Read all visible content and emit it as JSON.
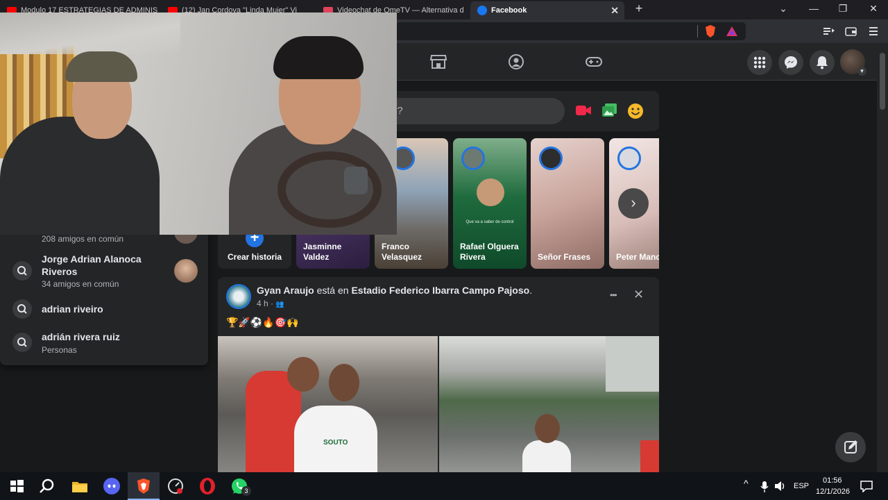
{
  "browser": {
    "tabs": [
      {
        "title": "Modulo 17 ESTRATEGIAS DE ADMINIS",
        "icon": "youtube-icon"
      },
      {
        "title": "(12) Jan Cordova \"Linda Mujer\" Vi",
        "icon": "youtube-icon"
      },
      {
        "title": "Videochat de OmeTV — Alternativa d",
        "icon": "ometv-icon"
      },
      {
        "title": "Facebook",
        "icon": "facebook-icon"
      }
    ],
    "new_tab": "+",
    "close": "✕"
  },
  "composer": {
    "placeholder_visible": "o?"
  },
  "stories": [
    {
      "name": "Crear historia"
    },
    {
      "name": "Jasminne Valdez"
    },
    {
      "name": "Franco Velasquez"
    },
    {
      "name": "Rafael Olguera Rivera"
    },
    {
      "name": "Señor Frases"
    },
    {
      "name": "Peter Manc Paita"
    }
  ],
  "story_caption": "Que va a saber de control",
  "search": {
    "items": [
      {
        "name": "",
        "sub": "208 amigos en común"
      },
      {
        "name": "Jorge Adrian Alanoca Riveros",
        "sub": "34 amigos en común"
      },
      {
        "name": "adrian riveiro",
        "sub": ""
      },
      {
        "name": "adrián rivera ruiz",
        "sub": "Personas"
      }
    ]
  },
  "post": {
    "author": "Gyan Araujo",
    "connector": "está en",
    "place": "Estadio Federico Ibarra Campo Pajoso",
    "period": ".",
    "time": "4 h ·",
    "emojis": "🏆🚀⚽🔥🎯🙌",
    "more": "•••",
    "close": "✕",
    "jersey_text": "SOUTO"
  },
  "taskbar": {
    "whatsapp_badge": "3",
    "lang": "ESP",
    "time": "01:56",
    "date": "12/1/2026"
  },
  "colors": {
    "fb_blue": "#2374e1",
    "bg": "#18191a",
    "card": "#242526"
  }
}
